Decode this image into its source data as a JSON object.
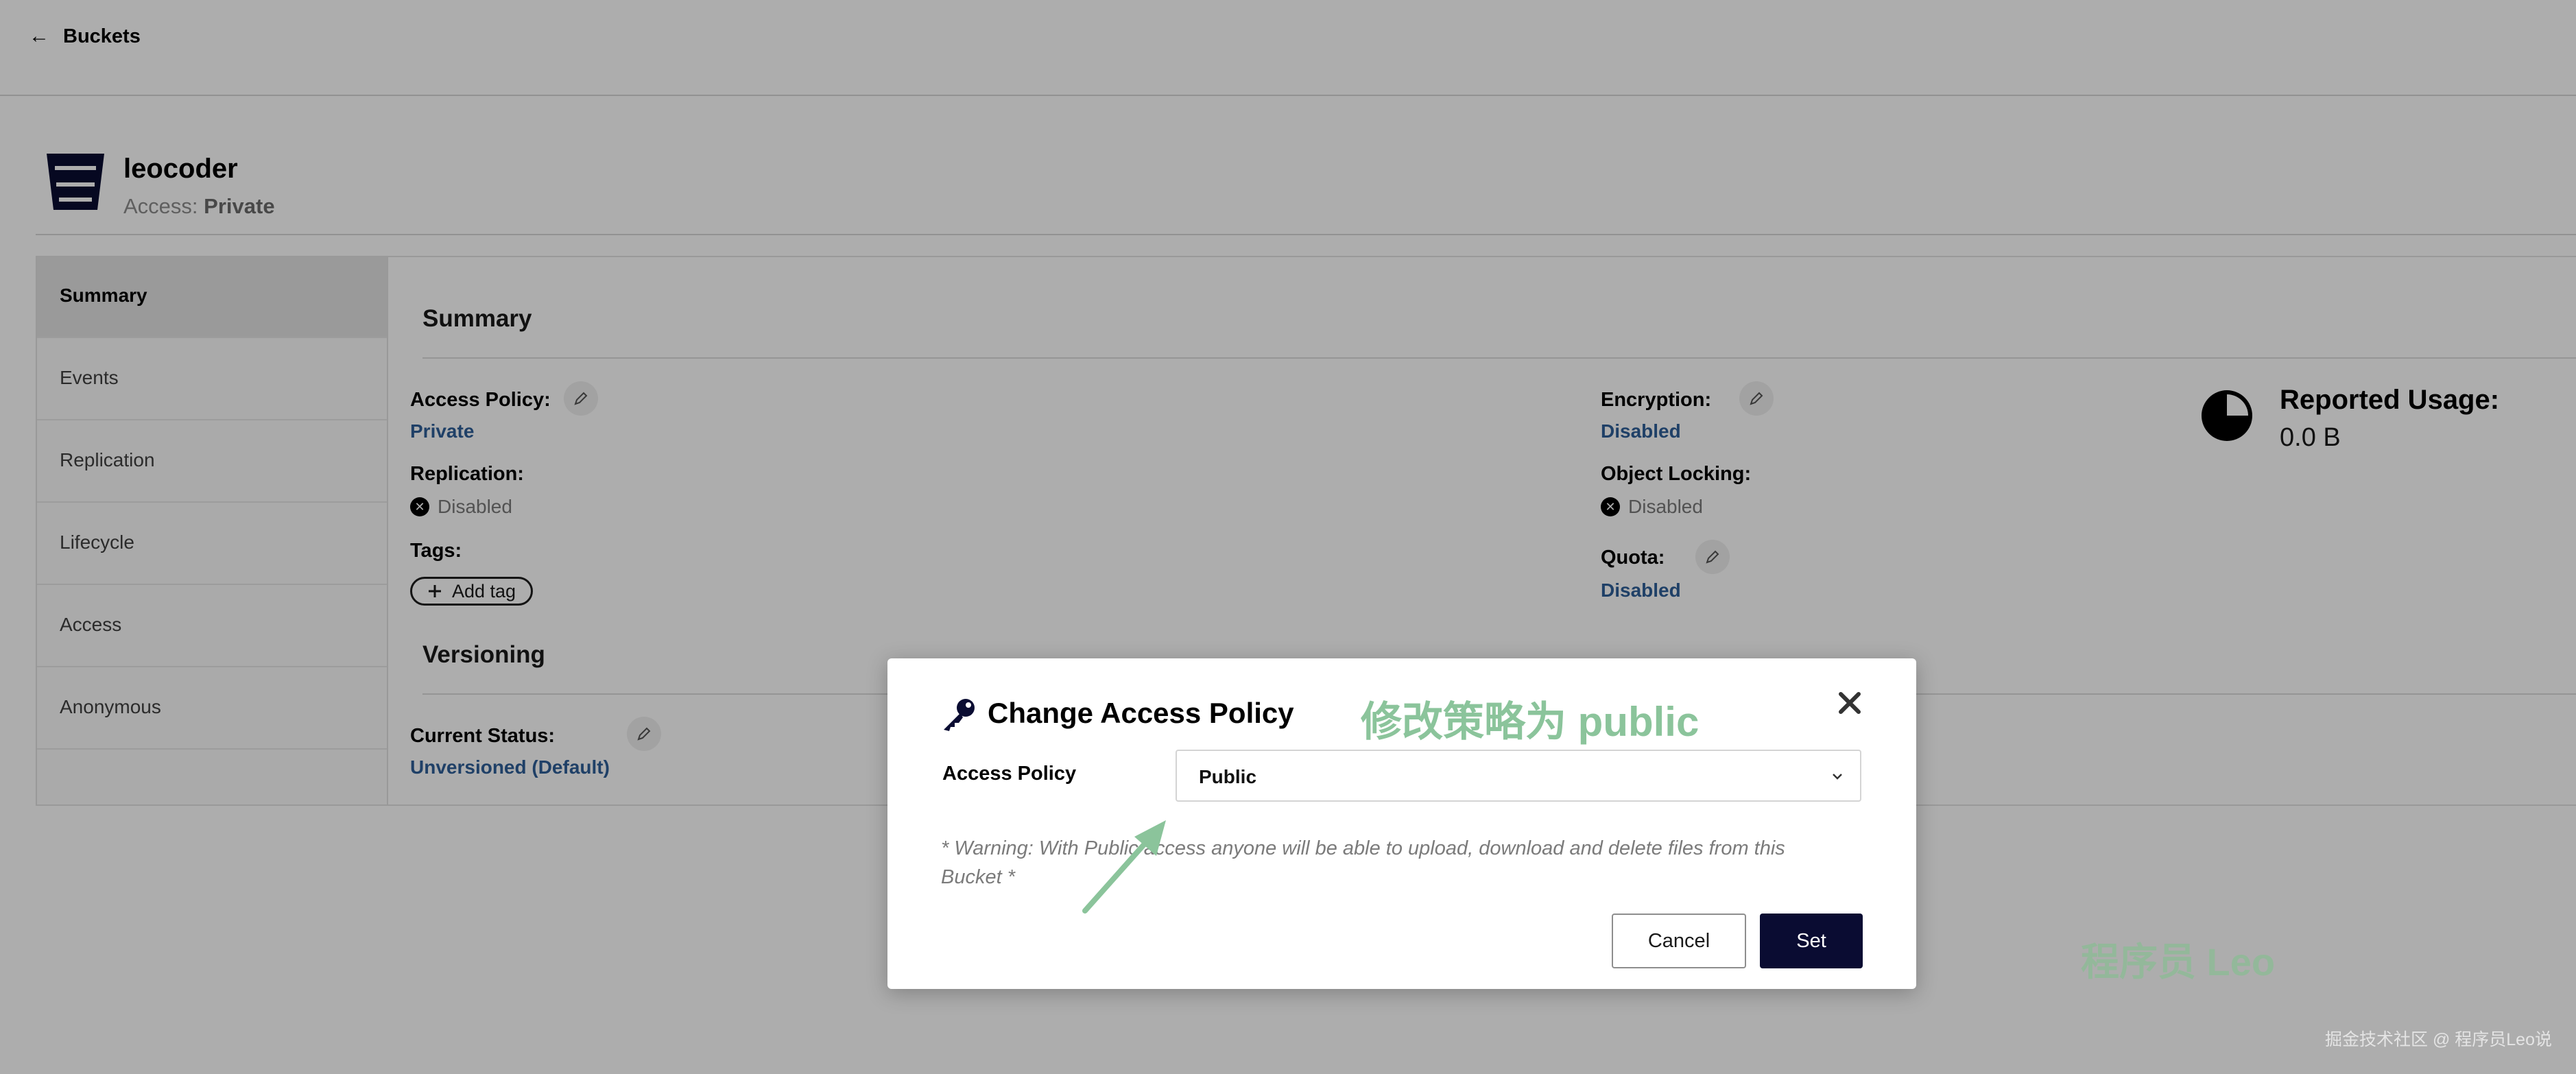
{
  "topbar": {
    "back_label": "Buckets",
    "back_icon": "arrow-left-icon"
  },
  "bucket": {
    "name": "leocoder",
    "access_label": "Access:",
    "access_value": "Private",
    "icon": "bucket-icon"
  },
  "sidebar": {
    "items": [
      {
        "label": "Summary",
        "active": true
      },
      {
        "label": "Events",
        "active": false
      },
      {
        "label": "Replication",
        "active": false
      },
      {
        "label": "Lifecycle",
        "active": false
      },
      {
        "label": "Access",
        "active": false
      },
      {
        "label": "Anonymous",
        "active": false
      }
    ]
  },
  "summary": {
    "title": "Summary",
    "access_policy_label": "Access Policy:",
    "access_policy_value": "Private",
    "replication_label": "Replication:",
    "replication_value": "Disabled",
    "tags_label": "Tags:",
    "add_tag_label": "Add tag",
    "encryption_label": "Encryption:",
    "encryption_value": "Disabled",
    "object_locking_label": "Object Locking:",
    "object_locking_value": "Disabled",
    "quota_label": "Quota:",
    "quota_value": "Disabled",
    "usage_title": "Reported Usage:",
    "usage_value": "0.0 B"
  },
  "versioning": {
    "title": "Versioning",
    "status_label": "Current Status:",
    "status_value": "Unversioned (Default)"
  },
  "modal": {
    "title": "Change Access Policy",
    "annotation": "修改策略为 public",
    "field_label": "Access Policy",
    "selected_value": "Public",
    "warning": "* Warning: With Public access anyone will be able to upload, download and delete files from this Bucket *",
    "cancel_label": "Cancel",
    "set_label": "Set",
    "annotation_color": "#8bc49b",
    "set_button_color": "#0a0c32"
  },
  "watermarks": {
    "big": "程序员 Leo",
    "small": "掘金技术社区 @ 程序员Leo说"
  }
}
